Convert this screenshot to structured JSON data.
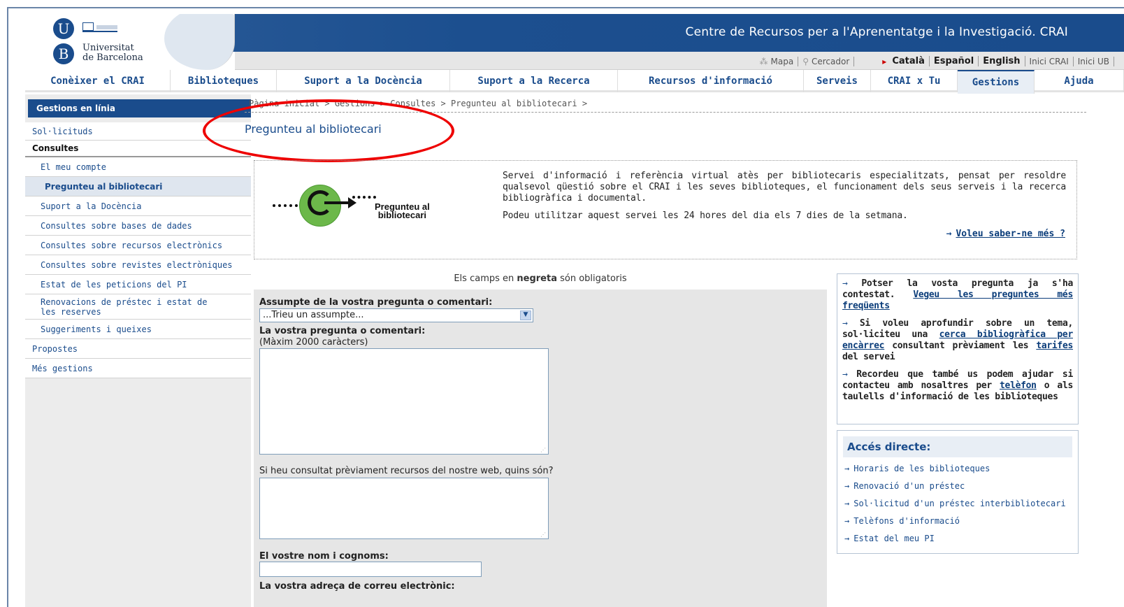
{
  "header": {
    "site_title": "Centre de Recursos per a l'Aprenentatge i la Investigació. CRAI",
    "logo_line1": "Universitat",
    "logo_line2": "de Barcelona",
    "logo_u": "U",
    "logo_b": "B"
  },
  "util": {
    "mapa": "Mapa",
    "cercador": "Cercador",
    "catala": "Català",
    "espanol": "Español",
    "english": "English",
    "inici_crai": "Inici CRAI",
    "inici_ub": "Inici UB"
  },
  "nav": {
    "items": [
      {
        "label": "Conèixer el CRAI"
      },
      {
        "label": "Biblioteques"
      },
      {
        "label": "Suport a la Docència"
      },
      {
        "label": "Suport a la Recerca"
      },
      {
        "label": "Recursos d'informació"
      },
      {
        "label": "Serveis"
      },
      {
        "label": "CRAI x Tu"
      },
      {
        "label": "Gestions"
      },
      {
        "label": "Ajuda"
      }
    ]
  },
  "sidebar": {
    "header": "Gestions en línia",
    "items": [
      {
        "label": "Sol·licituds"
      },
      {
        "label": "Consultes"
      },
      {
        "label": "El meu compte"
      },
      {
        "label": "Pregunteu al bibliotecari"
      },
      {
        "label": "Suport a la Docència"
      },
      {
        "label": "Consultes sobre bases de dades"
      },
      {
        "label": "Consultes sobre recursos electrònics"
      },
      {
        "label": "Consultes sobre revistes electròniques"
      },
      {
        "label": "Estat de les peticions del PI"
      },
      {
        "label": "Renovacions de préstec i estat de les reserves"
      },
      {
        "label": "Suggeriments i queixes"
      },
      {
        "label": "Propostes"
      },
      {
        "label": "Més gestions"
      }
    ]
  },
  "breadcrumb": "Pàgina inicial > Gestions > Consultes > Pregunteu al bibliotecari >",
  "page_title": "Pregunteu al bibliotecari",
  "promo": {
    "line1": "Pregunteu al",
    "line2": "bibliotecari"
  },
  "info": {
    "para1": "Servei d'informació i referència virtual atès per bibliotecaris especialitzats, pensat per resoldre qualsevol qüestió sobre el CRAI i les seves biblioteques, el funcionament dels seus serveis i la recerca bibliogràfica i documental.",
    "para2": "Podeu utilitzar aquest servei les 24 hores del dia els 7 dies de la setmana.",
    "more_link": "Voleu saber-ne més ?"
  },
  "form": {
    "required_note_pre": "Els camps en ",
    "required_note_bold": "negreta",
    "required_note_post": " són obligatoris",
    "subject_label": "Assumpte de la vostra pregunta o comentari:",
    "subject_value": "...Trieu un assumpte...",
    "question_label": "La vostra pregunta o comentari:",
    "question_hint": "(Màxim 2000 caràcters)",
    "resources_label": "Si heu consultat prèviament recursos del nostre web, quins són?",
    "name_label": "El vostre nom i cognoms:",
    "email_label": "La vostra adreça de correu electrònic:"
  },
  "help": {
    "p1_pre": "Potser la vosta pregunta ja s'ha contestat.",
    "p1_link": "Vegeu les preguntes més freqüents",
    "p2_pre": "Si voleu aprofundir sobre un tema, sol·liciteu una",
    "p2_link1": "cerca bibliogràfica per encàrrec",
    "p2_mid": "consultant prèviament les",
    "p2_link2": "tarifes",
    "p2_post": "del servei",
    "p3_pre": "Recordeu que també us podem ajudar si contacteu amb nosaltres per",
    "p3_link": "telèfon",
    "p3_post": "o als taulells d'informació de les biblioteques"
  },
  "acces": {
    "title": "Accés directe:",
    "items": [
      {
        "label": "Horaris de les biblioteques"
      },
      {
        "label": "Renovació d'un préstec"
      },
      {
        "label": "Sol·licitud d'un préstec interbibliotecari"
      },
      {
        "label": "Telèfons d'informació"
      },
      {
        "label": "Estat del meu PI"
      }
    ]
  }
}
